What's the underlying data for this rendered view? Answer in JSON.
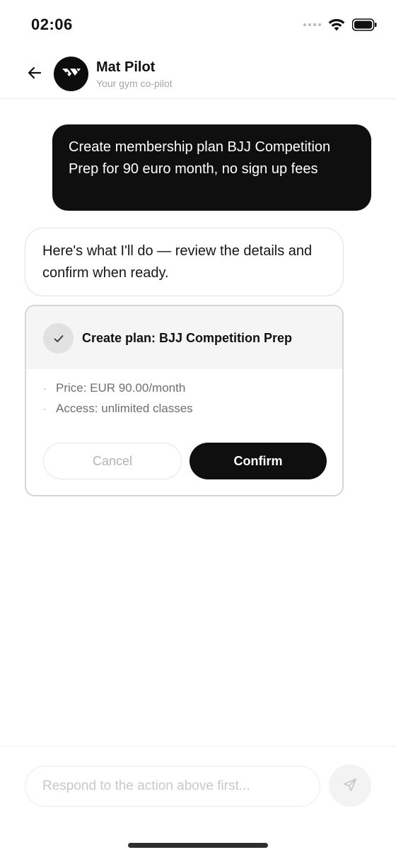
{
  "status_bar": {
    "time": "02:06"
  },
  "header": {
    "title": "Mat Pilot",
    "subtitle": "Your gym co-pilot",
    "back_icon": "arrow-left-icon",
    "avatar_icon": "mat-pilot-logo-icon"
  },
  "messages": {
    "user": "Create membership plan BJJ Competition Prep for 90 euro month, no sign up fees",
    "assistant": "Here's what I'll do — review the details and confirm when ready."
  },
  "action_card": {
    "title": "Create plan: BJJ Competition Prep",
    "status_icon": "check-icon",
    "details": [
      "Price: EUR 90.00/month",
      "Access: unlimited classes"
    ],
    "bullet": "·",
    "cancel_label": "Cancel",
    "confirm_label": "Confirm"
  },
  "composer": {
    "placeholder": "Respond to the action above first...",
    "send_icon": "send-icon"
  },
  "colors": {
    "primary": "#0f0f0f",
    "background": "#ffffff",
    "muted_text": "#a5a5a5",
    "card_header": "#f5f5f5"
  }
}
